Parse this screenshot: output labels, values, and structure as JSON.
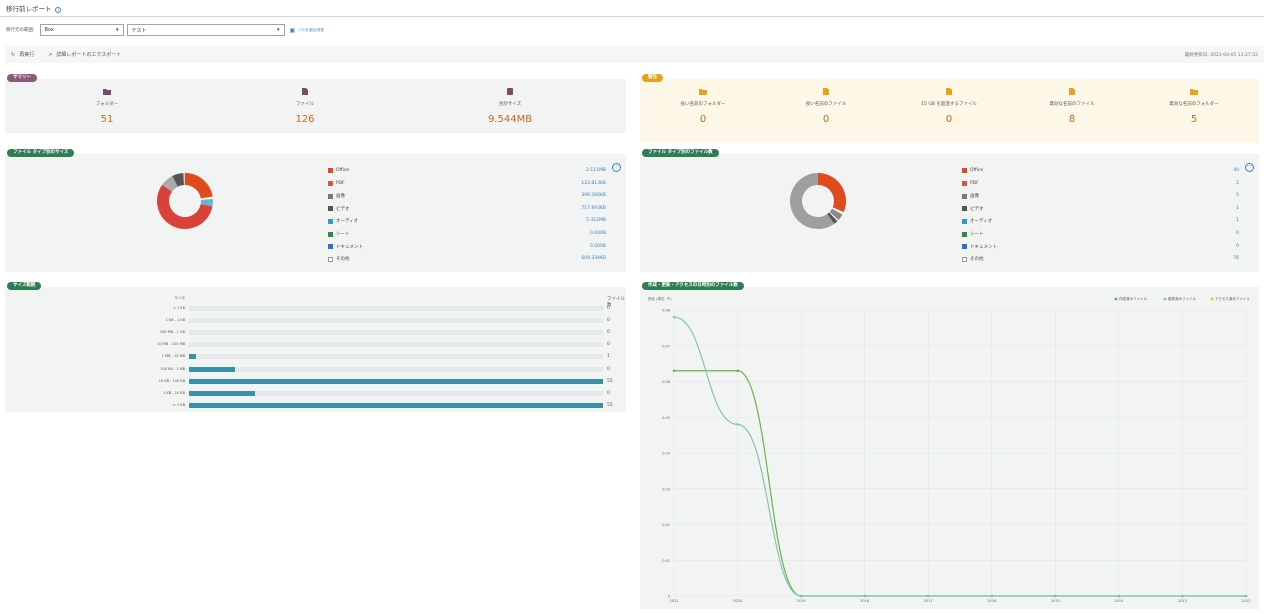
{
  "title": "移行前レポート",
  "filter": {
    "label": "移行元の範囲:",
    "source": "Box",
    "scope": "テスト",
    "link": "パスを追加/変更"
  },
  "actions": {
    "rerun": "再実行",
    "export": "詳細レポートのエクスポート",
    "timestamp": "最終更新日: 2021-04-05 13:27:52"
  },
  "summary": {
    "tag": "サマリー",
    "folders_label": "フォルダー",
    "folders": "51",
    "files_label": "ファイル",
    "files": "126",
    "size_label": "合計サイズ",
    "size": "9.544MB"
  },
  "warnings": {
    "tag": "警告",
    "items": [
      {
        "label": "長い名前のフォルダー",
        "value": "0"
      },
      {
        "label": "長い名前のファイル",
        "value": "0"
      },
      {
        "label": "15 GB を超過するファイル",
        "value": "0"
      },
      {
        "label": "無効な名前のファイル",
        "value": "8"
      },
      {
        "label": "無効な名前のフォルダー",
        "value": "5"
      }
    ]
  },
  "type_size": {
    "tag": "ファイル タイプ別のサイズ",
    "rows": [
      {
        "label": "Office",
        "value": "2.111MB"
      },
      {
        "label": "PDF",
        "value": "123.813KB"
      },
      {
        "label": "画像",
        "value": "396.566KB"
      },
      {
        "label": "ビデオ",
        "value": "717.893KB"
      },
      {
        "label": "オーディオ",
        "value": "5.322MB"
      },
      {
        "label": "シート",
        "value": "0.000B"
      },
      {
        "label": "ドキュメント",
        "value": "0.000B"
      },
      {
        "label": "その他",
        "value": "609.334KB"
      }
    ]
  },
  "type_count": {
    "tag": "ファイル タイプ別のファイル数",
    "rows": [
      {
        "label": "Office",
        "value": "40"
      },
      {
        "label": "PDF",
        "value": "2"
      },
      {
        "label": "画像",
        "value": "5"
      },
      {
        "label": "ビデオ",
        "value": "1"
      },
      {
        "label": "オーディオ",
        "value": "1"
      },
      {
        "label": "シート",
        "value": "0"
      },
      {
        "label": "ドキュメント",
        "value": "0"
      },
      {
        "label": "その他",
        "value": "76"
      }
    ]
  },
  "size_range": {
    "tag": "サイズ範囲",
    "col_size": "サイズ",
    "col_count": "ファイル数",
    "rows": [
      {
        "label": "< 1 KB",
        "count": "0",
        "fraction": 0
      },
      {
        "label": "1 KB - 1 KB",
        "count": "0",
        "fraction": 0
      },
      {
        "label": "100 MB - 1 GB",
        "count": "0",
        "fraction": 0
      },
      {
        "label": "10 MB - 100 MB",
        "count": "0",
        "fraction": 0
      },
      {
        "label": "1 MB - 10 MB",
        "count": "1",
        "fraction": 0.018
      },
      {
        "label": "100 KB - 1 MB",
        "count": "0",
        "fraction": 0.11
      },
      {
        "label": "10 KB - 100 KB",
        "count": "55",
        "fraction": 1.0
      },
      {
        "label": "1 KB - 10 KB",
        "count": "0",
        "fraction": 0.16
      },
      {
        "label": "> 1 KB",
        "count": "55",
        "fraction": 1.0
      }
    ]
  },
  "chart": {
    "tag": "作成・更新・アクセスの日時別のファイル数",
    "ylabel": "割合 (単位: 千)",
    "legend": [
      "作成済みファイル",
      "更新済みファイル",
      "アクセス済みファイル"
    ]
  },
  "chart_data": {
    "type": "line",
    "x": [
      "2021",
      "2020",
      "2019",
      "2018",
      "2017",
      "2016",
      "2015",
      "2014",
      "2013",
      "2012"
    ],
    "ylim": [
      0,
      0.08
    ],
    "yticks": [
      "0.08",
      "0.07",
      "0.06",
      "0.05",
      "0.04",
      "0.03",
      "0.02",
      "0.01",
      "0"
    ],
    "series": [
      {
        "name": "作成済みファイル",
        "color": "#6db33f",
        "values": [
          0.063,
          0.063,
          0,
          0,
          0,
          0,
          0,
          0,
          0,
          0
        ]
      },
      {
        "name": "更新済みファイル",
        "color": "#7cc7b4",
        "values": [
          0.078,
          0.048,
          0,
          0,
          0,
          0,
          0,
          0,
          0,
          0
        ]
      },
      {
        "name": "アクセス済みファイル",
        "color": "#e8c21a",
        "values": []
      }
    ]
  },
  "colors": {
    "office": "#e04a1c",
    "pdf": "#d9534f",
    "image": "#777777",
    "audio": "#2e9ad0",
    "sheet": "#2f8a4a",
    "doc": "#2b6fd6"
  }
}
